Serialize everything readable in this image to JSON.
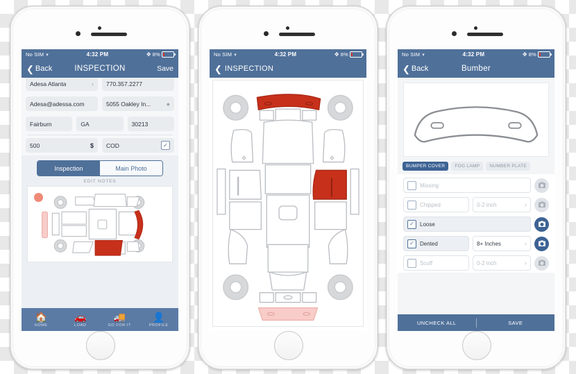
{
  "phone1": {
    "status": {
      "carrier": "No SIM",
      "wifi": "wifi-icon",
      "time": "4:32 PM",
      "bluetooth": "bluetooth-icon",
      "battery": "8%"
    },
    "nav": {
      "back": "Back",
      "title": "INSPECTION",
      "save": "Save"
    },
    "form": {
      "rows": [
        [
          {
            "value": "Adesa Atlanta",
            "tail": "›"
          },
          {
            "value": "770.357.2277",
            "tail": ""
          }
        ],
        [
          {
            "value": "Adesa@adessa.com",
            "tail": ""
          },
          {
            "value": "5055 Oakley  In...",
            "tail": "⌘"
          }
        ],
        [
          {
            "value": "Fairburn",
            "tail": ""
          },
          {
            "value": "GA",
            "tail": ""
          },
          {
            "value": "30213",
            "tail": ""
          }
        ]
      ],
      "amount": "500",
      "currency": "$",
      "payment": "COD",
      "paid_checked": "✓"
    },
    "segments": {
      "left": "Inspection",
      "right": "Main Photo"
    },
    "edit_notes": "EDIT NOTES",
    "tabs": [
      {
        "icon": "home-icon",
        "label": "HOME"
      },
      {
        "icon": "car-icon",
        "label": "LOAD"
      },
      {
        "icon": "truck-icon",
        "label": "GO FOR IT"
      },
      {
        "icon": "profile-icon",
        "label": "PROFILE"
      }
    ]
  },
  "phone2": {
    "status": {
      "carrier": "No SIM",
      "time": "4:32 PM",
      "battery": "8%"
    },
    "nav": {
      "title": "INSPECTION"
    }
  },
  "phone3": {
    "status": {
      "carrier": "No SIM",
      "time": "4:32 PM",
      "battery": "8%"
    },
    "nav": {
      "back": "Back",
      "title": "Bumber"
    },
    "chips": [
      {
        "label": "BUMPER COVER",
        "active": true
      },
      {
        "label": "FOG LAMP",
        "active": false
      },
      {
        "label": "NUMBER PLATE",
        "active": false
      }
    ],
    "damage_rows": [
      {
        "label": "Missing",
        "checked": false,
        "size": null,
        "camera": false
      },
      {
        "label": "Chipped",
        "checked": false,
        "size": "0-2 inch",
        "camera": false
      },
      {
        "label": "Loose",
        "checked": true,
        "size": null,
        "camera": true
      },
      {
        "label": "Dented",
        "checked": true,
        "size": "8+ Inches",
        "camera": true
      },
      {
        "label": "Scuff",
        "checked": false,
        "size": "0-2 inch",
        "camera": false
      }
    ],
    "footer": {
      "uncheck": "UNCHECK ALL",
      "save": "SAVE"
    },
    "check_glyph": "✓",
    "arrow_glyph": "›"
  },
  "colors": {
    "header_blue": "#4f7099",
    "chip_blue": "#3d6394",
    "damage_red": "#c7301a",
    "light_red": "#f8ccc9",
    "tabbar_blue": "#5b7ba5"
  }
}
